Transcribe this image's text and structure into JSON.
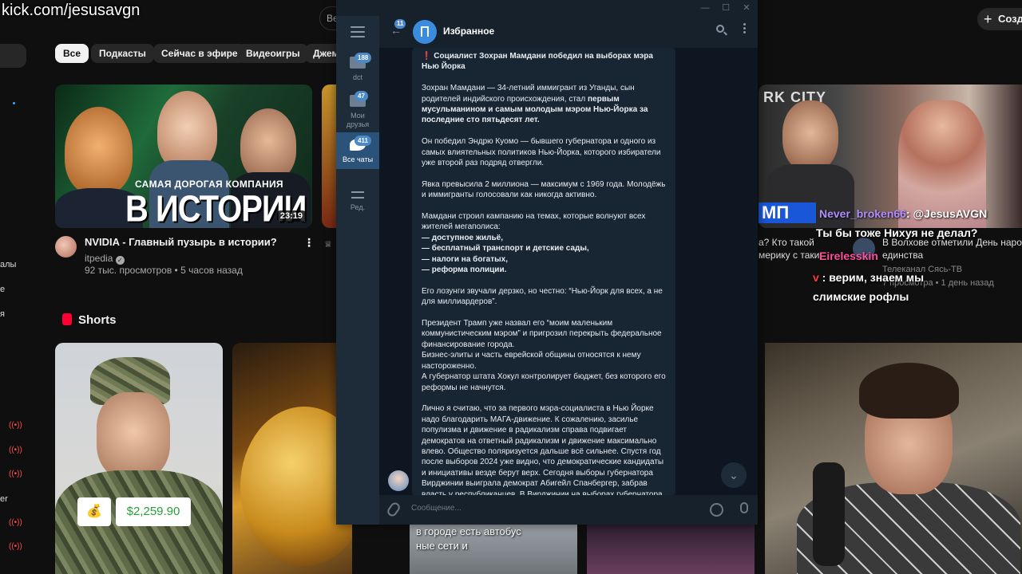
{
  "overlay": {
    "watermark": "kick.com/jesusavgn"
  },
  "youtube": {
    "search_partial": "Ве",
    "create_label": "Созд",
    "chips": [
      "Все",
      "Подкасты",
      "Сейчас в эфире",
      "Видеоигры",
      "Джем"
    ],
    "sidebar_fragments": [
      "алы",
      "е",
      "я",
      "er"
    ],
    "video": {
      "title": "NVIDIA - Главный пузырь в истории?",
      "channel": "itpedia",
      "meta": "92 тыс. просмотров • 5 часов назад",
      "duration": "23:19",
      "thumb_caption_small": "САМАЯ ДОРОГАЯ КОМПАНИЯ",
      "thumb_caption_big": "В ИСТОРИИ"
    },
    "right_video": {
      "thumb_text": "RK CITY",
      "tag": "МП",
      "title_left_line1": "а? Кто такой",
      "title_left_line2": "мерику с таки",
      "title_right_line1": "В Волхове отметили День наро",
      "title_right_line2": "единства",
      "channel": "Телеканал Сясь-ТВ",
      "meta": "7 просмотра • 1 день назад"
    },
    "shorts_title": "Shorts",
    "short_amount": "$2,259.90",
    "bottom_caption_line1": "в городе есть автобус",
    "bottom_caption_line2": "ные сети и"
  },
  "stream_chat": [
    {
      "user": "Never_broken66",
      "text": ": @JesusAVGN"
    },
    {
      "user": "",
      "text": "Ты бы тоже Нихуя не делал?"
    },
    {
      "user": "Eirelesskin",
      "text": ""
    },
    {
      "user": "v",
      "text": " : верим, знаем мы"
    },
    {
      "user": "",
      "text": "слимские рофлы"
    }
  ],
  "telegram": {
    "chat_title": "Избранное",
    "back_badge": "11",
    "folders": [
      {
        "label": "dct",
        "badge": "188"
      },
      {
        "label": "Мои друзья",
        "badge": "47"
      },
      {
        "label": "Все чаты",
        "badge": "411"
      }
    ],
    "edit_label": "Ред.",
    "compose_placeholder": "Сообщение...",
    "message": {
      "headline": "Социалист Зохран Мамдани победил на выборах мэра Нью Йорка",
      "p1_plain": "Зохран Мамдани — 34-летний иммигрант из Уганды, сын родителей индийского происхождения, стал ",
      "p1_bold": "первым мусульманином и самым молодым мэром Нью-Йорка за последние сто пятьдесят лет.",
      "p2": "Он победил Эндрю Куомо — бывшего губернатора и одного из самых влиятельных политиков Нью-Йорка, которого избиратели уже второй раз подряд отвергли.",
      "p3": "Явка превысила 2 миллиона — максимум с 1969 года. Молодёжь и иммигранты голосовали как никогда активно.",
      "p4_intro": "Мамдани строил кампанию на темах, которые волнуют всех жителей мегаполиса:",
      "p4_items": [
        "— доступное жильё,",
        "— бесплатный транспорт и детские сады,",
        "— налоги на богатых,",
        "— реформа полиции."
      ],
      "p5": "Его лозунги звучали дерзко, но честно: “Нью-Йорк для всех, а не для миллиардеров”.",
      "p6": "Президент Трамп уже назвал его “моим маленьким коммунистическим мэром” и пригрозил перекрыть федеральное финансирование города.",
      "p6b": "Бизнес-элиты и часть еврейской общины относятся к нему настороженно.",
      "p6c": "А губернатор штата Хокул контролирует бюджет, без которого его реформы не начнутся.",
      "p7": "Лично я считаю, что за первого мэра-социалиста в Нью Йорке надо благодарить МАГА-движение. К сожалению, засилье популизма и движение в радикализм справа подвигает демократов на ответный радикализм и движение максимально влево. Общество поляризуется дальше всё сильнее. Спустя год после выборов 2024 уже видно, что демократические кандидаты и инициативы везде берут верх. Сегодня выборы губернатора Вирджинии выиграла демократ Абигейл Спанбергер, забрав власть у республиканцев. В Вирджинии на выборах губернатора"
    }
  }
}
